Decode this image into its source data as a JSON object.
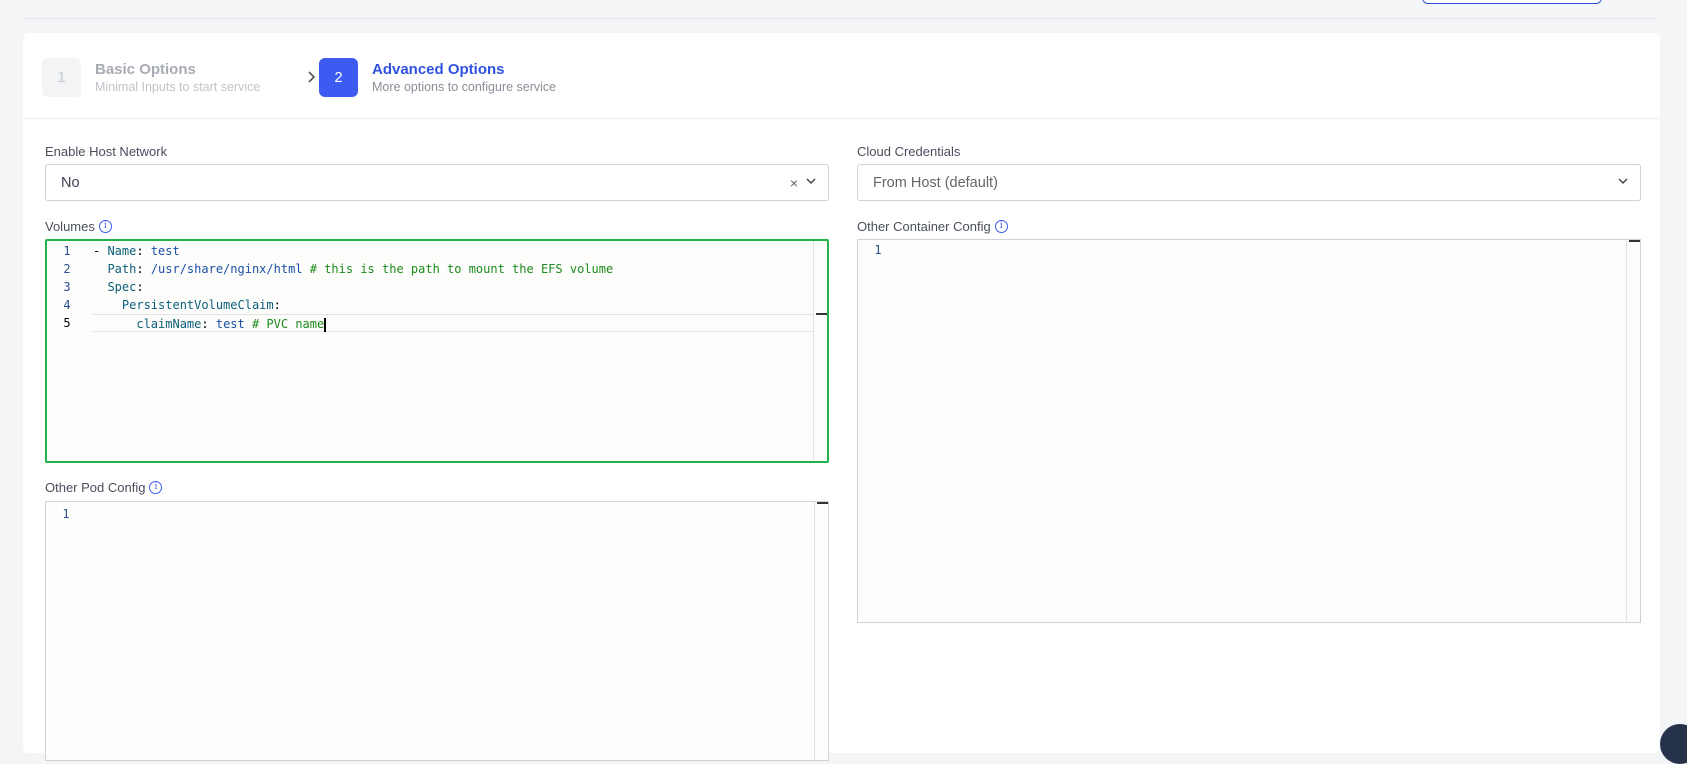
{
  "steps": [
    {
      "number": "1",
      "title": "Basic Options",
      "subtitle": "Minimal Inputs to start service"
    },
    {
      "number": "2",
      "title": "Advanced Options",
      "subtitle": "More options to configure service"
    }
  ],
  "host_network": {
    "label": "Enable Host Network",
    "value": "No",
    "clear_symbol": "×"
  },
  "cloud_credentials": {
    "label": "Cloud Credentials",
    "value": "From Host (default)"
  },
  "volumes": {
    "label": "Volumes",
    "line_numbers": [
      "1",
      "2",
      "3",
      "4",
      "5"
    ],
    "lines": [
      {
        "dash": "- ",
        "key": "Name",
        "sep": ": ",
        "value": "test",
        "comment": ""
      },
      {
        "dash": "  ",
        "key": "Path",
        "sep": ": ",
        "value": "/usr/share/nginx/html",
        "comment": " # this is the path to mount the EFS volume"
      },
      {
        "dash": "  ",
        "key": "Spec",
        "sep": ":",
        "value": "",
        "comment": ""
      },
      {
        "dash": "    ",
        "key": "PersistentVolumeClaim",
        "sep": ":",
        "value": "",
        "comment": ""
      },
      {
        "dash": "      ",
        "key": "claimName",
        "sep": ": ",
        "value": "test",
        "comment": " # PVC name"
      }
    ]
  },
  "other_pod_config": {
    "label": "Other Pod Config",
    "line_numbers": [
      "1"
    ]
  },
  "other_container_config": {
    "label": "Other Container Config",
    "line_numbers": [
      "1"
    ]
  },
  "icons": {
    "info": "info-icon",
    "chevron_right": "chevron-right-icon",
    "chevron_down": "chevron-down-icon",
    "close": "close-icon"
  },
  "colors": {
    "accent": "#3d5bf0",
    "focus_border": "#22b24c",
    "comment": "#1c8a1c"
  }
}
